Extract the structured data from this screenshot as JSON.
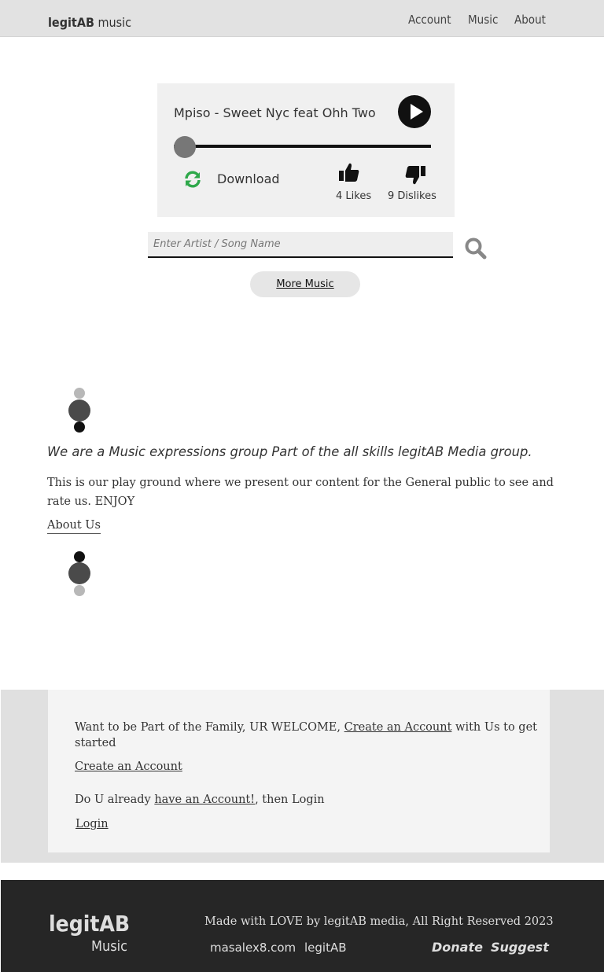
{
  "header": {
    "brand_bold": "legitAB",
    "brand_rest": " music",
    "nav": [
      "Account",
      "Music",
      "About"
    ]
  },
  "player": {
    "song_title": "Mpiso - Sweet Nyc feat Ohh Two",
    "progress_fraction": 0,
    "download_label": "Download",
    "likes": "4 Likes",
    "dislikes": "9 Dislikes",
    "icons": [
      "play-icon",
      "refresh-icon",
      "thumbs-up-icon",
      "thumbs-down-icon"
    ]
  },
  "search": {
    "placeholder": "Enter Artist / Song Name",
    "value": ""
  },
  "more_music": "More Music",
  "about": {
    "tagline": "We are a Music expressions group Part of the all skills legitAB Media group.",
    "description": "This is our play ground where we present our content for the General public to see and rate us. ENJOY",
    "link": "About Us"
  },
  "join": {
    "line_before": "Want to be Part of the Family, UR WELCOME, ",
    "line_link": "Create an Account",
    "line_after": " with Us to get started",
    "create_link": "Create an Account",
    "already_before": "Do U already ",
    "already_link": "have an Account!",
    "already_after": ", then Login",
    "login_link": "Login"
  },
  "footer": {
    "logo_top": "legitAB",
    "logo_bottom": "Music",
    "credit": "Made with LOVE by legitAB media,  All Right Reserved 2023",
    "links": [
      "masalex8.com",
      "legitAB"
    ],
    "donate": "Donate",
    "suggest": "Suggest"
  },
  "colors": {
    "header_bg": "#e2e2e2",
    "player_bg": "#f0f0f0",
    "refresh_icon": "#2ea84a",
    "footer_bg": "#262626",
    "join_bg": "#e0e0e0"
  }
}
